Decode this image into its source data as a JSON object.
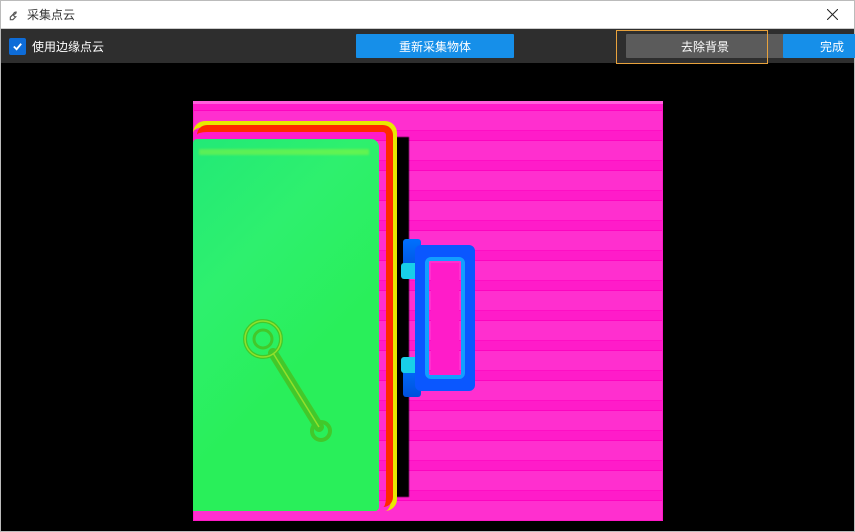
{
  "window": {
    "title": "采集点云",
    "close_label": "Close"
  },
  "toolbar": {
    "use_edge_pointcloud_label": "使用边缘点云",
    "recollect_label": "重新采集物体",
    "remove_bg_label": "去除背景",
    "done_label": "完成"
  },
  "colors": {
    "accent_blue": "#168fe9",
    "button_gray": "#5b5b5b",
    "highlight_border": "#e8a23c",
    "toolbar_bg": "#2e2e2e"
  },
  "viewport": {
    "description": "depth-pointcloud-preview"
  }
}
